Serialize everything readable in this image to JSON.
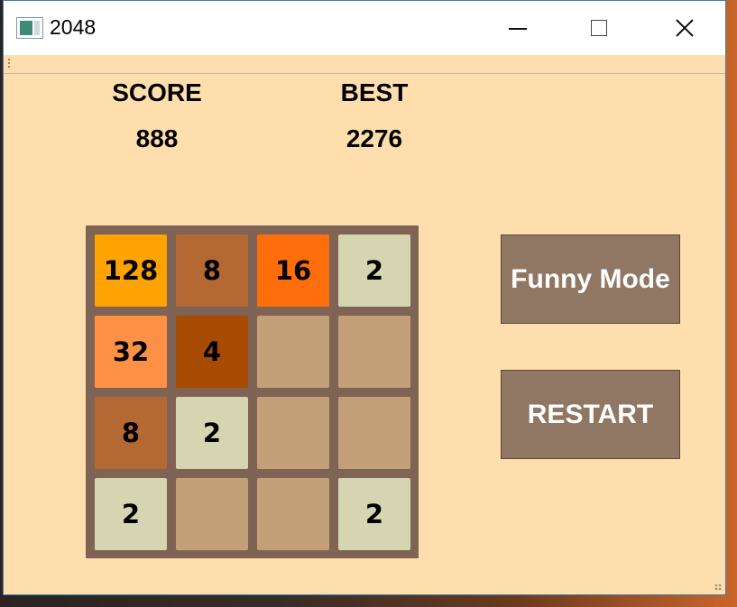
{
  "window": {
    "title": "2048",
    "icon": "app-window-icon"
  },
  "titlebar_buttons": {
    "minimize": "minimize-icon",
    "maximize": "maximize-icon",
    "close": "close-icon",
    "close_glyph": "✕"
  },
  "scoreboard": {
    "score_label": "SCORE",
    "score_value": "888",
    "best_label": "BEST",
    "best_value": "2276"
  },
  "board": {
    "rows": 4,
    "cols": 4,
    "tiles": [
      [
        "128",
        "8",
        "16",
        "2"
      ],
      [
        "32",
        "4",
        "",
        ""
      ],
      [
        "8",
        "2",
        "",
        ""
      ],
      [
        "2",
        "",
        "",
        "2"
      ]
    ]
  },
  "tile_colors": {
    "empty": "#c3a077",
    "2": "#d5d6b1",
    "4": "#a74b02",
    "8": "#b56932",
    "16": "#ff6e0b",
    "32": "#ff9146",
    "128": "#ffa302"
  },
  "buttons": {
    "funny_mode": "Funny Mode",
    "restart": "RESTART"
  },
  "colors": {
    "background": "#fedeac",
    "board": "#7f6455",
    "button": "#8f7763"
  }
}
